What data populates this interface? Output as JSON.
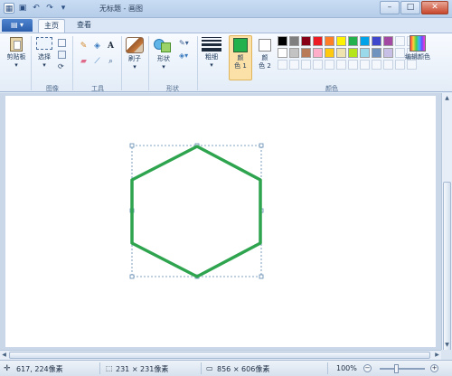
{
  "window": {
    "title": "无标题 - 画图",
    "controls": {
      "minimize": "–",
      "maximize": "□",
      "close": "✕"
    }
  },
  "tabs": {
    "file_label": "▤ ▾",
    "home": "主页",
    "view": "查看"
  },
  "ribbon": {
    "clipboard": {
      "label": "剪贴板"
    },
    "image": {
      "select_label": "选择",
      "group_label": "图像"
    },
    "tools": {
      "group_label": "工具",
      "text_glyph": "A"
    },
    "brushes": {
      "label": "刷子"
    },
    "shapes": {
      "label": "形状",
      "group_label": "形状"
    },
    "size": {
      "label": "粗细"
    },
    "color1": {
      "label_line1": "颜",
      "label_line2": "色 1",
      "color": "#22b14c"
    },
    "color2": {
      "label_line1": "颜",
      "label_line2": "色 2",
      "color": "#ffffff"
    },
    "colors": {
      "group_label": "颜色",
      "palette_row1": [
        "#000000",
        "#7f7f7f",
        "#880015",
        "#ed1c24",
        "#ff7f27",
        "#fff200",
        "#22b14c",
        "#00a2e8",
        "#3f48cc",
        "#a349a4"
      ],
      "palette_row2": [
        "#ffffff",
        "#c3c3c3",
        "#b97a57",
        "#ffaec9",
        "#ffc90e",
        "#efe4b0",
        "#b5e61d",
        "#99d9ea",
        "#7092be",
        "#c8bfe7"
      ],
      "edit_label": "编辑颜色"
    }
  },
  "canvas": {
    "shape": "hexagon",
    "stroke_color": "#2ea44f",
    "selection_border_color": "#5a86b0"
  },
  "statusbar": {
    "cursor_position": "617, 224像素",
    "selection_size": "231 × 231像素",
    "image_size": "856 × 606像素",
    "zoom": "100%"
  }
}
